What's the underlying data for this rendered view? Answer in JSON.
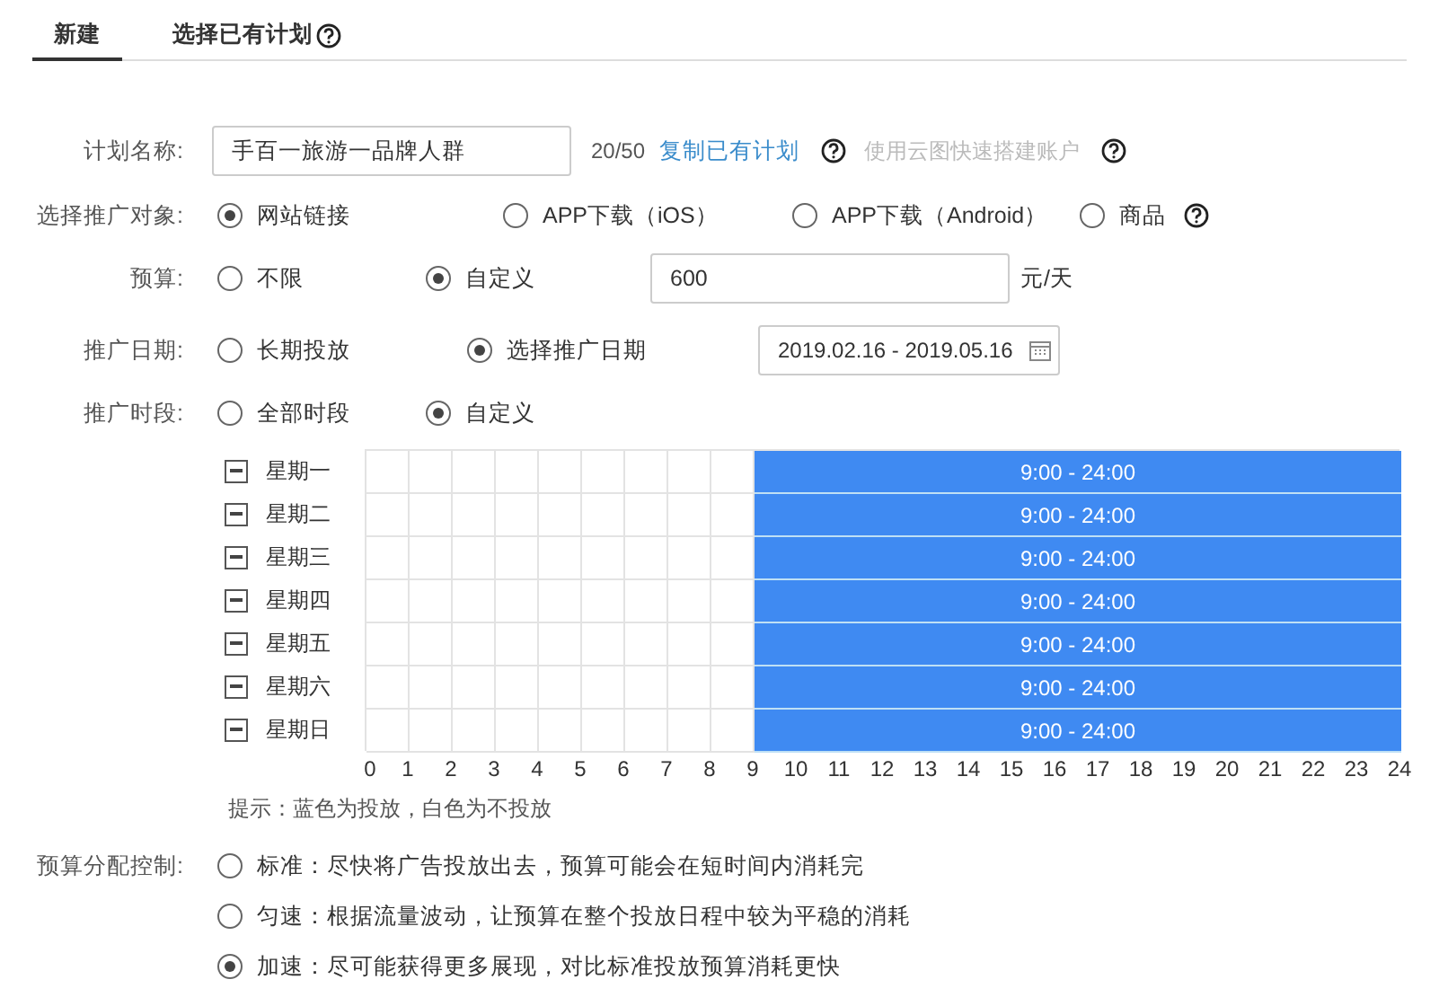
{
  "tabs": [
    {
      "label": "新建",
      "selected": true,
      "help": false
    },
    {
      "label": "选择已有计划",
      "selected": false,
      "help": true
    }
  ],
  "plan_name": {
    "label": "计划名称:",
    "value": "手百一旅游一品牌人群",
    "counter": "20/50",
    "copy_link": "复制已有计划",
    "cloud_link": "使用云图快速搭建账户",
    "cloud_disabled": true
  },
  "target": {
    "label": "选择推广对象:",
    "options": [
      {
        "label": "网站链接",
        "selected": true,
        "help": false
      },
      {
        "label": "APP下载（iOS）",
        "selected": false,
        "help": false
      },
      {
        "label": "APP下载（Android）",
        "selected": false,
        "help": false
      },
      {
        "label": "商品",
        "selected": false,
        "help": true
      }
    ]
  },
  "budget": {
    "label": "预算:",
    "options": [
      {
        "label": "不限",
        "selected": false
      },
      {
        "label": "自定义",
        "selected": true
      }
    ],
    "value": "600",
    "unit": "元/天"
  },
  "dates": {
    "label": "推广日期:",
    "options": [
      {
        "label": "长期投放",
        "selected": false
      },
      {
        "label": "选择推广日期",
        "selected": true
      }
    ],
    "range": "2019.02.16 - 2019.05.16"
  },
  "time_slots": {
    "label": "推广时段:",
    "options": [
      {
        "label": "全部时段",
        "selected": false
      },
      {
        "label": "自定义",
        "selected": true
      }
    ]
  },
  "schedule": {
    "hours": [
      "0",
      "1",
      "2",
      "3",
      "4",
      "5",
      "6",
      "7",
      "8",
      "9",
      "10",
      "11",
      "12",
      "13",
      "14",
      "15",
      "16",
      "17",
      "18",
      "19",
      "20",
      "21",
      "22",
      "23",
      "24"
    ],
    "days": [
      {
        "label": "星期一",
        "partial": true,
        "range_label": "9:00 - 24:00",
        "level": 0.625
      },
      {
        "label": "星期二",
        "partial": true,
        "range_label": "9:00 - 24:00",
        "level": 0.625
      },
      {
        "label": "星期三",
        "partial": true,
        "range_label": "9:00 - 24:00",
        "level": 0.625
      },
      {
        "label": "星期四",
        "partial": true,
        "range_label": "9:00 - 24:00",
        "level": 0.625
      },
      {
        "label": "星期五",
        "partial": true,
        "range_label": "9:00 - 24:00",
        "level": 0.625
      },
      {
        "label": "星期六",
        "partial": true,
        "range_label": "9:00 - 24:00",
        "level": 0.625
      },
      {
        "label": "星期日",
        "partial": true,
        "range_label": "9:00 - 24:00",
        "level": 0.625
      }
    ],
    "hint": "提示：蓝色为投放，白色为不投放"
  },
  "budget_control": {
    "label": "预算分配控制:",
    "options": [
      {
        "label": "标准：尽快将广告投放出去，预算可能会在短时间内消耗完",
        "selected": false
      },
      {
        "label": "匀速：根据流量波动，让预算在整个投放日程中较为平稳的消耗",
        "selected": false
      },
      {
        "label": "加速：尽可能获得更多展现，对比标准投放预算消耗更快",
        "selected": true
      }
    ]
  }
}
